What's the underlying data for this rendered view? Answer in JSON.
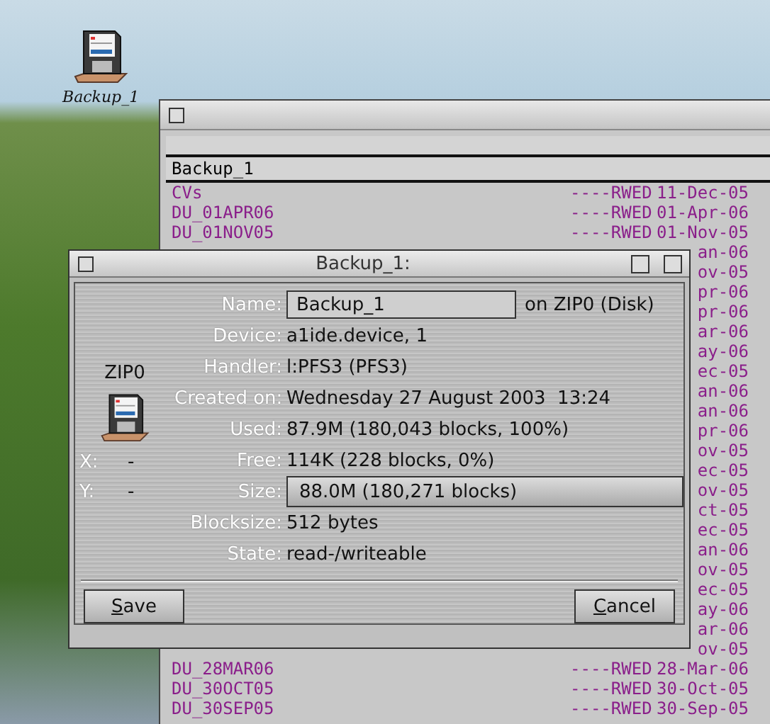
{
  "desktop": {
    "icons": [
      {
        "label": "Backup_1"
      }
    ]
  },
  "list_window": {
    "path": "Backup_1",
    "rows": [
      {
        "kind": "full",
        "name": "CVs",
        "protection": "----RWED",
        "date": "11-Dec-05"
      },
      {
        "kind": "full",
        "name": "DU_01APR06",
        "protection": "----RWED",
        "date": "01-Apr-06"
      },
      {
        "kind": "full",
        "name": "DU_01NOV05",
        "protection": "----RWED",
        "date": "01-Nov-05"
      },
      {
        "kind": "tail",
        "date": "an-06"
      },
      {
        "kind": "tail",
        "date": "ov-05"
      },
      {
        "kind": "tail",
        "date": "pr-06"
      },
      {
        "kind": "tail",
        "date": "pr-06"
      },
      {
        "kind": "tail",
        "date": "ar-06"
      },
      {
        "kind": "tail",
        "date": "ay-06"
      },
      {
        "kind": "tail",
        "date": "ec-05"
      },
      {
        "kind": "tail",
        "date": "an-06"
      },
      {
        "kind": "tail",
        "date": "an-06"
      },
      {
        "kind": "tail",
        "date": "pr-06"
      },
      {
        "kind": "tail",
        "date": "ov-05"
      },
      {
        "kind": "tail",
        "date": "ec-05"
      },
      {
        "kind": "tail",
        "date": "ov-05"
      },
      {
        "kind": "tail",
        "date": "ct-05"
      },
      {
        "kind": "tail",
        "date": "ec-05"
      },
      {
        "kind": "tail",
        "date": "an-06"
      },
      {
        "kind": "tail",
        "date": "ov-05"
      },
      {
        "kind": "tail",
        "date": "ec-05"
      },
      {
        "kind": "tail",
        "date": "ay-06"
      },
      {
        "kind": "tail",
        "date": "ar-06"
      },
      {
        "kind": "tail",
        "date": "ov-05"
      },
      {
        "kind": "full",
        "name": "DU_28MAR06",
        "protection": "----RWED",
        "date": "28-Mar-06"
      },
      {
        "kind": "full",
        "name": "DU_30OCT05",
        "protection": "----RWED",
        "date": "30-Oct-05"
      },
      {
        "kind": "full",
        "name": "DU_30SEP05",
        "protection": "----RWED",
        "date": "30-Sep-05"
      }
    ]
  },
  "info_dialog": {
    "title": "Backup_1:",
    "volume": "ZIP0",
    "x_label": "X:",
    "x_value": "-",
    "y_label": "Y:",
    "y_value": "-",
    "fields": [
      {
        "kind": "input",
        "label": "Name:",
        "value": "Backup_1",
        "suffix": "on ZIP0 (Disk)"
      },
      {
        "kind": "text",
        "label": "Device:",
        "value": "a1ide.device, 1"
      },
      {
        "kind": "text",
        "label": "Handler:",
        "value": "l:PFS3 (PFS3)"
      },
      {
        "kind": "text",
        "label": "Created on:",
        "value": "Wednesday 27 August 2003  13:24"
      },
      {
        "kind": "text",
        "label": "Used:",
        "value": "87.9M (180,043 blocks, 100%)"
      },
      {
        "kind": "text",
        "label": "Free:",
        "value": "114K (228 blocks, 0%)"
      },
      {
        "kind": "box",
        "label": "Size:",
        "value": "88.0M (180,271 blocks)"
      },
      {
        "kind": "text",
        "label": "Blocksize:",
        "value": "512 bytes"
      },
      {
        "kind": "text",
        "label": "State:",
        "value": "read-/writeable"
      }
    ],
    "buttons": [
      {
        "hotkey": "S",
        "label_rest": "ave"
      },
      {
        "hotkey": "C",
        "label_rest": "ancel"
      }
    ]
  }
}
